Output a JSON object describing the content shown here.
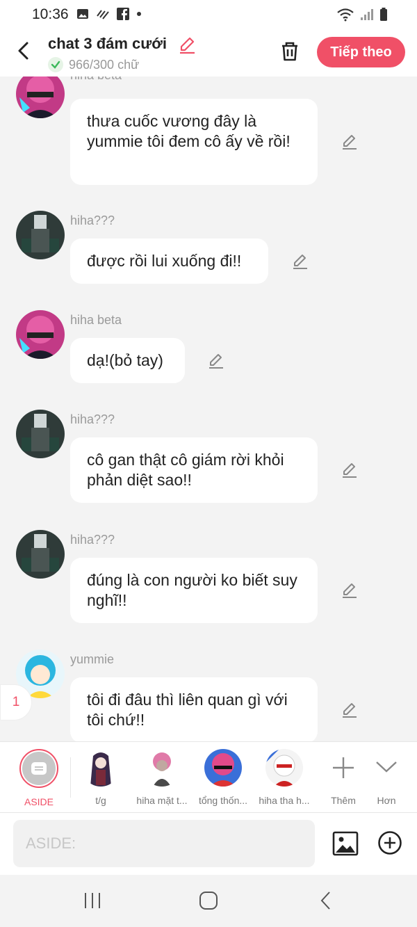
{
  "status": {
    "time": "10:36"
  },
  "header": {
    "title": "chat 3 đám cưới",
    "word_count": "966/300 chữ",
    "next_label": "Tiếp theo"
  },
  "messages": [
    {
      "name": "hiha beta",
      "text": "thưa cuốc vương đây là yummie tôi đem cô ấy về rồi!"
    },
    {
      "name": "hiha???",
      "text": "được rồi lui xuống đi!!"
    },
    {
      "name": "hiha beta",
      "text": "dạ!(bỏ tay)"
    },
    {
      "name": "hiha???",
      "text": "cô gan thật cô giám rời khỏi phản diệt sao!!"
    },
    {
      "name": "hiha???",
      "text": "đúng là con người ko biết suy nghĩ!!"
    },
    {
      "name": "yummie",
      "text": "tôi đi đâu thì liên quan gì với tôi chứ!!"
    }
  ],
  "unread_badge": "1",
  "characters": [
    {
      "label": "ASIDE"
    },
    {
      "label": "t/g"
    },
    {
      "label": "hiha mặt t..."
    },
    {
      "label": "tổng thốn..."
    },
    {
      "label": "hiha tha h..."
    },
    {
      "label": "Thêm"
    },
    {
      "label": "Hơn"
    }
  ],
  "input": {
    "placeholder": "ASIDE:"
  },
  "colors": {
    "accent": "#f05067",
    "bubble": "#ffffff",
    "background": "#f3f3f3"
  }
}
